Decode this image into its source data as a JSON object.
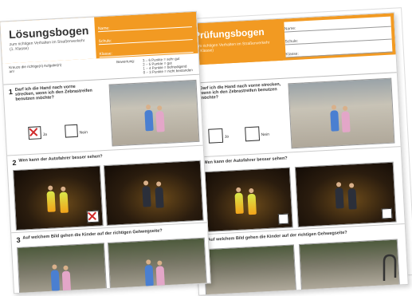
{
  "left_sheet": {
    "title": "Lösungsbogen",
    "subtitle": "zum richtigen Verhalten im Straßenverkehr (1. Klasse)",
    "fields": [
      "Name:",
      "Schule:",
      "Klasse:"
    ],
    "legend_left": "Kreuze die richtige(n) Aufgabe(n) an!",
    "legend_mid": "Bewertung:",
    "legend_points": [
      "3 – 6 Punkte = sehr gut",
      "2 – 5 Punkte = gut",
      "1 – 4 Punkte = befriedigend",
      "0 – 3 Punkte = nicht bestanden"
    ],
    "questions": [
      {
        "num": "1",
        "text": "Darf ich die Hand nach vorne strecken, wenn ich den Zebrastreifen benutzen möchte?",
        "opt_yes": "Ja",
        "opt_no": "Nein"
      },
      {
        "num": "2",
        "text": "Wen kann der Autofahrer besser sehen?"
      },
      {
        "num": "3",
        "text": "Auf welchem Bild gehen die Kinder auf der richtigen Gehwegseite?"
      }
    ]
  },
  "right_sheet": {
    "title": "Prüfungsbogen",
    "subtitle": "zum richtigen Verhalten im Straßenverkehr (1. Klasse)",
    "fields": [
      "Name:",
      "Schule:",
      "Klasse:"
    ],
    "questions": [
      {
        "num": "1",
        "text": "Darf ich die Hand nach vorne strecken, wenn ich den Zebrastreifen benutzen möchte?",
        "opt_yes": "Ja",
        "opt_no": "Nein"
      },
      {
        "num": "2",
        "text": "Wen kann der Autofahrer besser sehen?"
      },
      {
        "num": "3",
        "text": "Auf welchem Bild gehen die Kinder auf der richtigen Gehwegseite?"
      }
    ]
  },
  "colors": {
    "accent": "#f29a22",
    "check": "#d12a2a"
  }
}
